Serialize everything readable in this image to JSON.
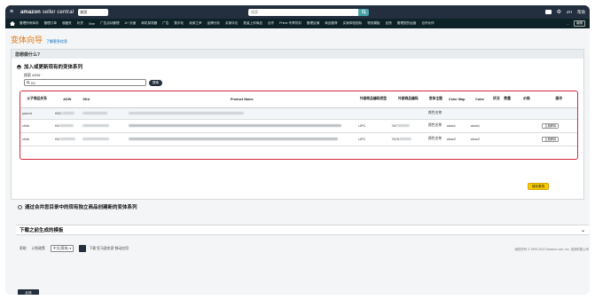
{
  "topbar": {
    "logo_brand": "amazon",
    "logo_suffix": " seller central",
    "store_label": "美国",
    "search_placeholder": "搜索",
    "lang_label": "ZH",
    "help_label": "帮助"
  },
  "nav": {
    "items": [
      "管理所有库存",
      "管理订单",
      "收藏夹",
      "补货",
      "Vine",
      "广告活动管理",
      "A+ 页面",
      "商机探测器",
      "广告",
      "数字化",
      "卖家之声",
      "品牌分析",
      "买家评论",
      "批量上传商品",
      "合作",
      "Prime 专享折扣",
      "管理店铺",
      "商品推荐",
      "买家体验指标",
      "物流模板",
      "反馈",
      "管理您的运营",
      "合作伙伴"
    ],
    "more_label": "...",
    "edit_label": "编辑"
  },
  "page": {
    "title": "变体向导",
    "title_link": "了解更多信息"
  },
  "panel": {
    "heading": "您想做什么?",
    "option1_label": "加入或更新现有的变体系列",
    "asin_label": "搜索 ASIN",
    "asin_value": "B0",
    "search_button": "搜索",
    "option2_label": "通过合并您目录中的现有独立商品创建新的变体系列",
    "save_button": "保存更改"
  },
  "table": {
    "headers": [
      "父子商品关系",
      "ASIN",
      "SKU",
      "Product Name",
      "外部商品编码类型",
      "外部商品编码",
      "变体主题",
      "Color Map",
      "Color",
      "状况",
      "数量",
      "价格",
      "操作"
    ],
    "rows": [
      {
        "relation": "parent",
        "asin": "B0C",
        "ext_type": "",
        "ext_id": "",
        "theme": "颜色名称",
        "color_map": "",
        "color": "",
        "action": ""
      },
      {
        "relation": "child",
        "asin": "B0",
        "ext_type": "UPC",
        "ext_id": "767",
        "theme": "颜色名称",
        "color_map": "clear1",
        "color": "clear1",
        "action": "主题移除"
      },
      {
        "relation": "child",
        "asin": "B0",
        "ext_type": "UPC",
        "ext_id": "7676",
        "theme": "颜色名称",
        "color_map": "clear2",
        "color": "clear2",
        "action": "主题移除"
      }
    ]
  },
  "templates": {
    "heading": "下载之前生成的模板"
  },
  "footer": {
    "help": "帮助",
    "program_policy": "计划政策",
    "language": "中文(简体)",
    "app_text": "下载\"亚马逊卖家\"移动应用",
    "copyright": "版权所有 © 1999-2022 Amazon.com, Inc. 或其附属公司"
  },
  "feedback_label": "反馈"
}
